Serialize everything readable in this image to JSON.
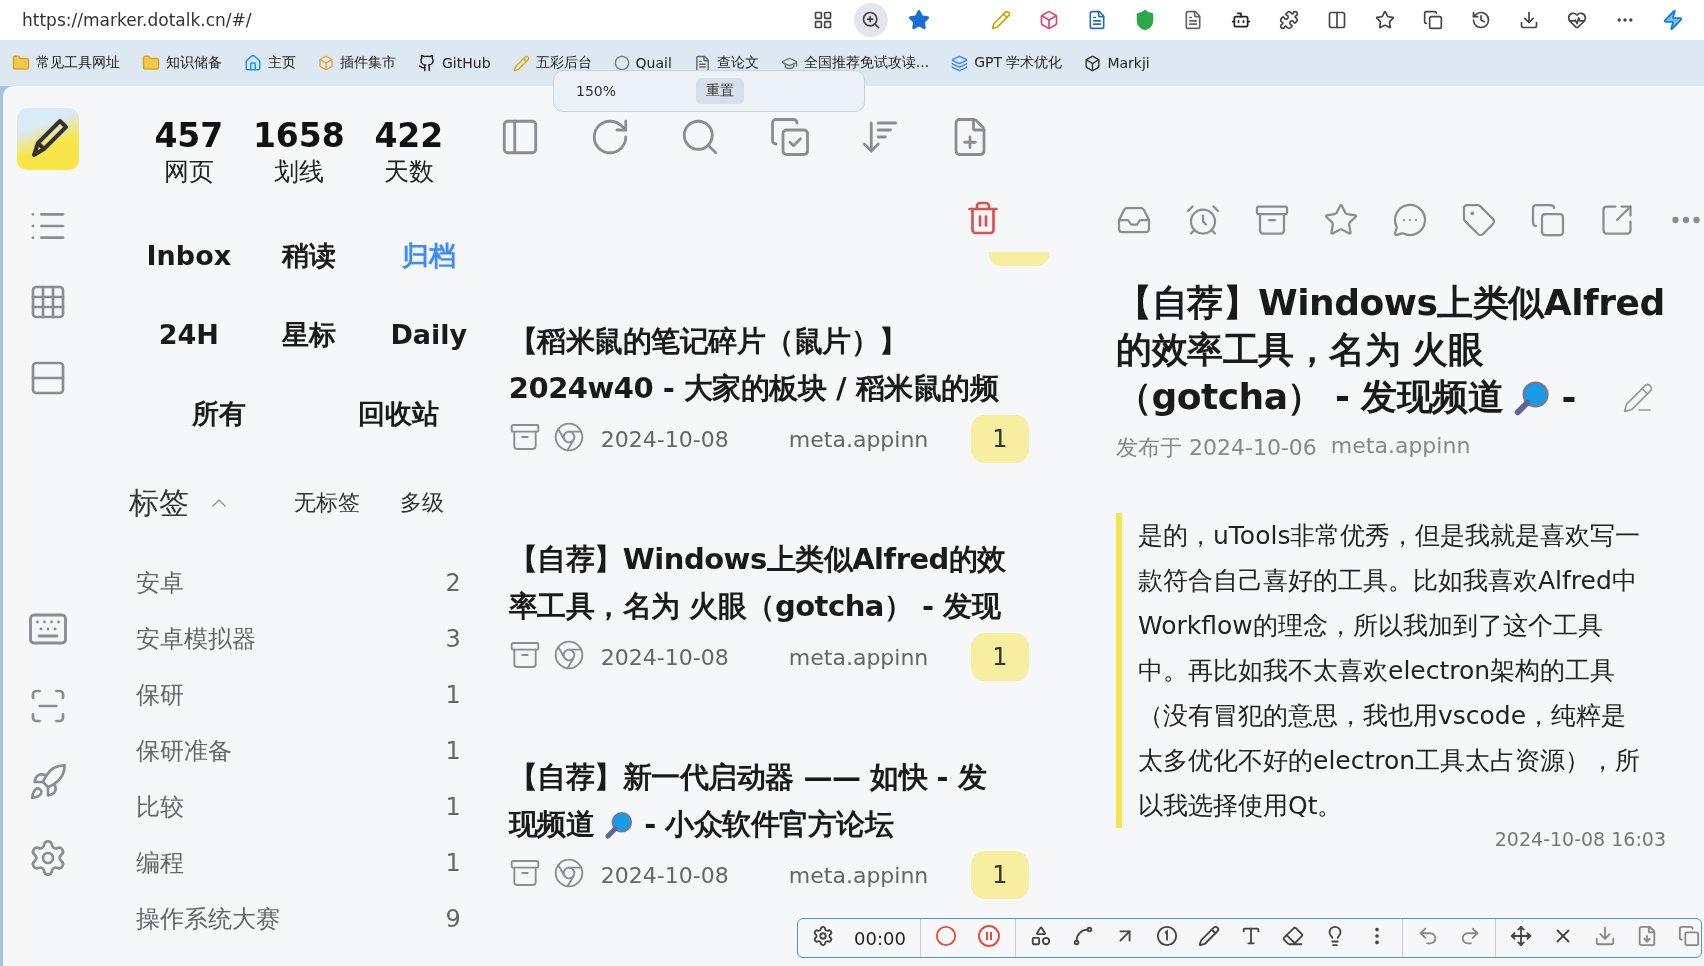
{
  "browser": {
    "url": "https://marker.dotalk.cn/#/",
    "bookmarks": [
      {
        "label": "常见工具网址",
        "kind": "folder"
      },
      {
        "label": "知识储备",
        "kind": "folder"
      },
      {
        "label": "主页",
        "kind": "home"
      },
      {
        "label": "插件集市",
        "kind": "plugin"
      },
      {
        "label": "GitHub",
        "kind": "github"
      },
      {
        "label": "五彩后台",
        "kind": "marker"
      },
      {
        "label": "Quail",
        "kind": "quail"
      },
      {
        "label": "查论文",
        "kind": "paper"
      },
      {
        "label": "全国推荐免试攻读...",
        "kind": "school"
      },
      {
        "label": "GPT 学术优化",
        "kind": "gpt"
      },
      {
        "label": "Markji",
        "kind": "markji"
      }
    ],
    "zoom_popup": {
      "value": "150%",
      "reset": "重置"
    }
  },
  "stats": [
    {
      "value": "457",
      "label": "网页"
    },
    {
      "value": "1658",
      "label": "划线"
    },
    {
      "value": "422",
      "label": "天数"
    }
  ],
  "views": [
    [
      {
        "label": "Inbox",
        "selected": false
      },
      {
        "label": "稍读",
        "selected": false
      },
      {
        "label": "归档",
        "selected": true
      }
    ],
    [
      {
        "label": "24H",
        "selected": false
      },
      {
        "label": "星标",
        "selected": false
      },
      {
        "label": "Daily",
        "selected": false
      }
    ],
    [
      {
        "label": "所有",
        "selected": false
      },
      {
        "label": "回收站",
        "selected": false
      }
    ]
  ],
  "tags": {
    "title": "标签",
    "expanded": true,
    "options": [
      "无标签",
      "多级"
    ],
    "items": [
      {
        "name": "安卓",
        "count": "2"
      },
      {
        "name": "安卓模拟器",
        "count": "3"
      },
      {
        "name": "保研",
        "count": "1"
      },
      {
        "name": "保研准备",
        "count": "1"
      },
      {
        "name": "比较",
        "count": "1"
      },
      {
        "name": "编程",
        "count": "1"
      },
      {
        "name": "操作系统大赛",
        "count": "9"
      }
    ]
  },
  "articles": [
    {
      "title_lines": [
        [
          "【稻米鼠的笔记碎片（鼠片）】"
        ],
        [
          "2024w40 - 大家的板块 / 稻米鼠的频"
        ]
      ],
      "date": "2024-10-08",
      "domain": "meta.appinn",
      "count": "1"
    },
    {
      "title_lines": [
        [
          "【自荐】Windows上类似Alfred的效"
        ],
        [
          "率工具，名为 火眼（gotcha） - 发现"
        ]
      ],
      "date": "2024-10-08",
      "domain": "meta.appinn",
      "count": "1"
    },
    {
      "title_lines": [
        [
          "【自荐】新一代启动器 —— 如快 - 发"
        ],
        [
          "现频道",
          "- 小众软件官方论坛"
        ]
      ],
      "date": "2024-10-08",
      "domain": "meta.appinn",
      "count": "1"
    }
  ],
  "detail": {
    "title_lines": [
      [
        "【自荐】Windows上类似Alfred"
      ],
      [
        "的效率工具，名为 火眼"
      ],
      [
        "（gotcha） - 发现频道",
        "-"
      ]
    ],
    "published": "发布于 2024-10-06",
    "domain": "meta.appinn",
    "highlight": "是的，uTools非常优秀，但是我就是喜欢写一款符合自己喜好的工具。比如我喜欢Alfred中Workflow的理念，所以我加到了这个工具中。再比如我不太喜欢electron架构的工具（没有冒犯的意思，我也用vscode，纯粹是太多优化不好的electron工具太占资源），所以我选择使用Qt。",
    "time": "2024-10-08 16:03"
  },
  "recorder": {
    "time": "00:00"
  }
}
